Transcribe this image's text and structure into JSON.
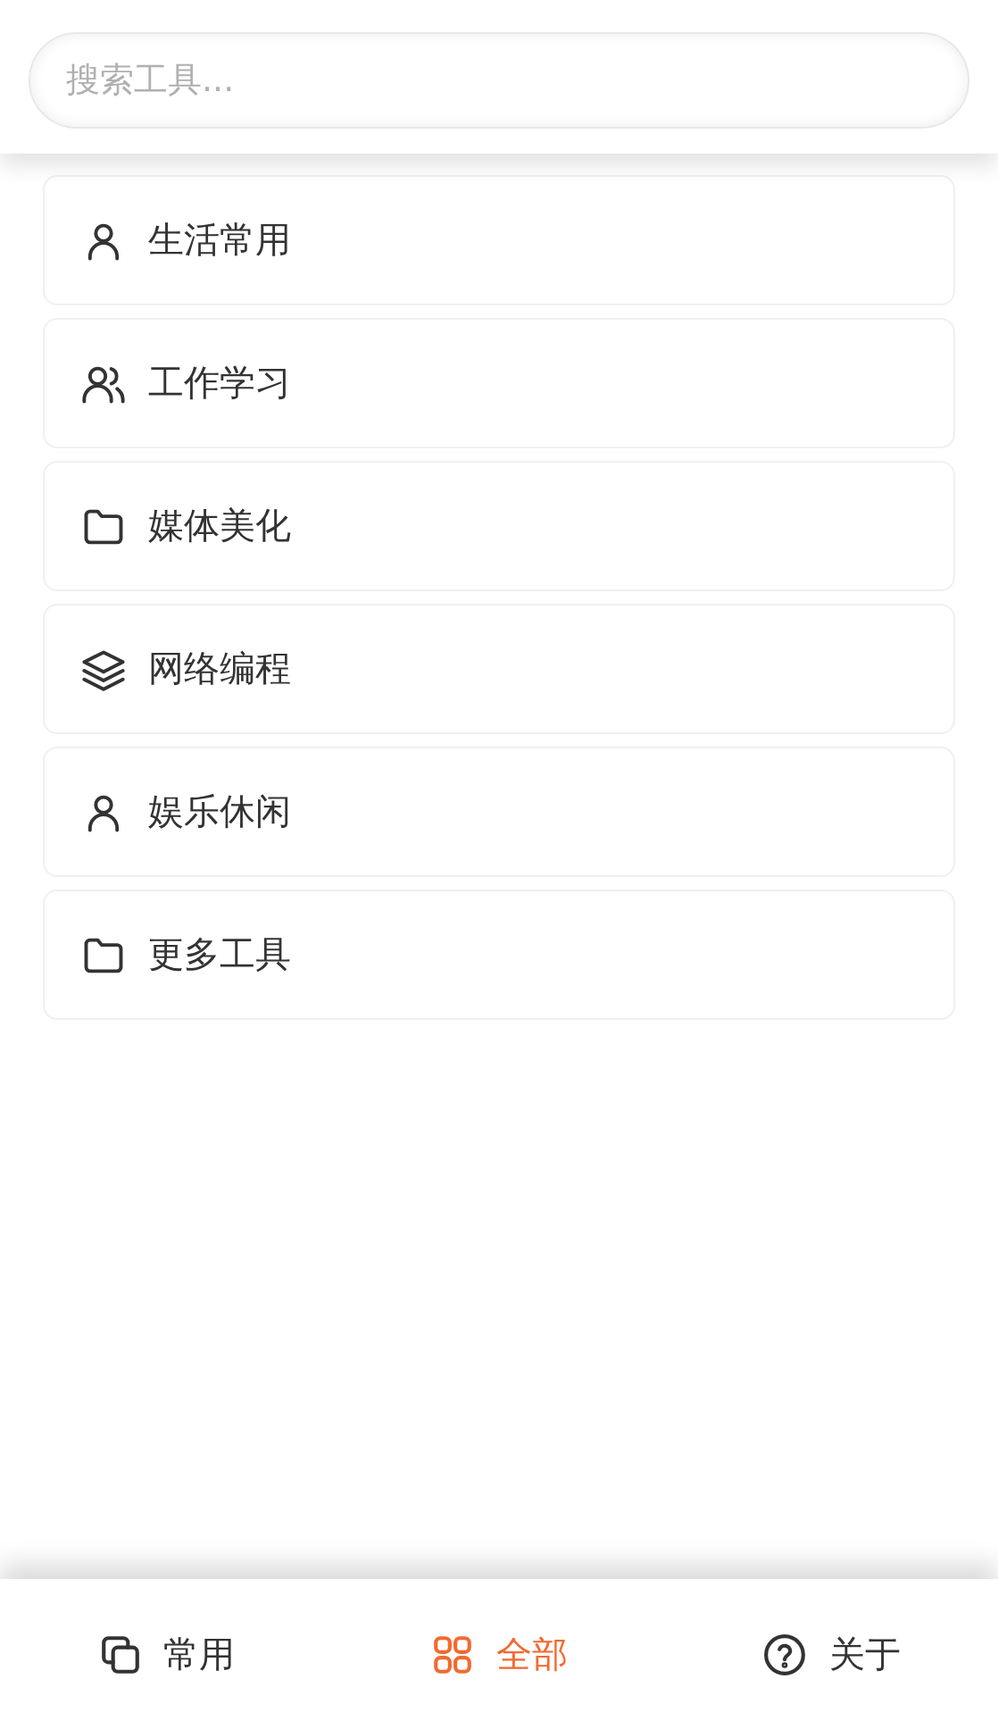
{
  "search": {
    "placeholder": "搜索工具..."
  },
  "categories": [
    {
      "label": "生活常用",
      "kind": "person"
    },
    {
      "label": "工作学习",
      "kind": "group"
    },
    {
      "label": "媒体美化",
      "kind": "folder"
    },
    {
      "label": "网络编程",
      "kind": "layers"
    },
    {
      "label": "娱乐休闲",
      "kind": "person"
    },
    {
      "label": "更多工具",
      "kind": "folder"
    }
  ],
  "tabs": [
    {
      "label": "常用",
      "kind": "copy",
      "selected": false
    },
    {
      "label": "全部",
      "kind": "grid",
      "selected": true
    },
    {
      "label": "关于",
      "kind": "help",
      "selected": false
    }
  ]
}
